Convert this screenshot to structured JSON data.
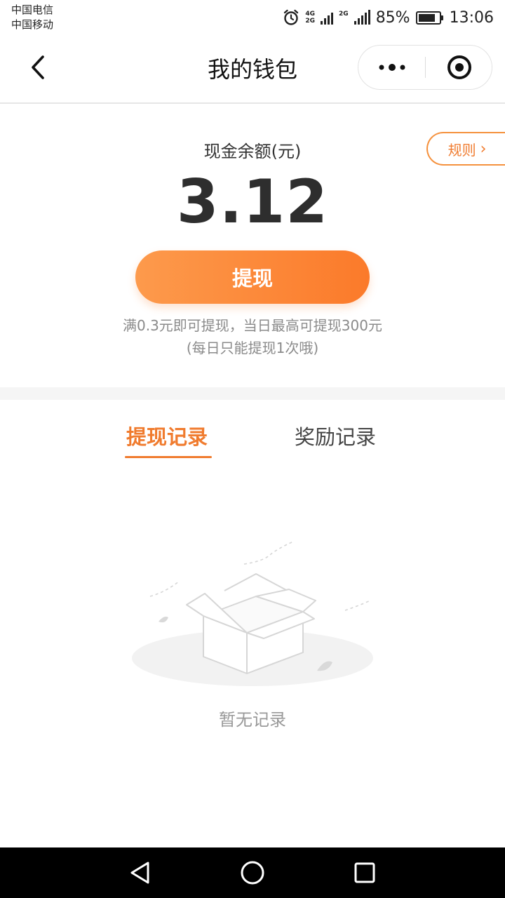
{
  "status_bar": {
    "carrier_1": "中国电信",
    "carrier_2": "中国移动",
    "net_1_top": "4G",
    "net_1_bottom": "2G",
    "net_2": "2G",
    "battery_percent": "85%",
    "battery_level": 0.85,
    "time": "13:06"
  },
  "nav_bar": {
    "title": "我的钱包",
    "icons": {
      "back": "chevron-left-icon",
      "more": "more-dots-icon",
      "close": "target-circle-icon"
    }
  },
  "balance": {
    "label": "现金余额(元)",
    "amount": "3.12",
    "rules_label": "规则",
    "rules_arrow": "›",
    "withdraw_label": "提现",
    "hint_line_1": "满0.3元即可提现，当日最高可提现300元",
    "hint_line_2": "(每日只能提现1次哦)"
  },
  "tabs": [
    {
      "label": "提现记录",
      "active": true
    },
    {
      "label": "奖励记录",
      "active": false
    }
  ],
  "empty_state": {
    "text": "暂无记录",
    "icon": "empty-box-icon"
  },
  "colors": {
    "accent": "#f07b2e",
    "button_gradient_start": "#fd9a4c",
    "button_gradient_end": "#fb7a2a"
  }
}
